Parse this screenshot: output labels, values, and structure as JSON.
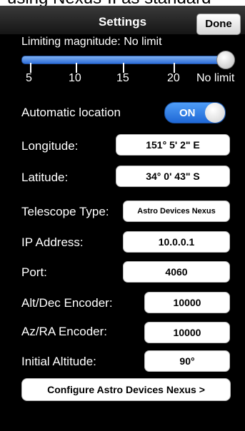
{
  "header_strip": {
    "text": "using Nexus-II as standard"
  },
  "navbar": {
    "title": "Settings",
    "done_label": "Done"
  },
  "limiting_magnitude": {
    "label": "Limiting magnitude: No limit",
    "ticks": [
      "5",
      "10",
      "15",
      "20",
      "No limit"
    ],
    "value": "No limit"
  },
  "automatic_location": {
    "label": "Automatic location",
    "toggle_label": "ON",
    "on": true
  },
  "longitude": {
    "label": "Longitude:",
    "value": "151° 5' 2\" E"
  },
  "latitude": {
    "label": "Latitude:",
    "value": "34° 0' 43\" S"
  },
  "telescope_type": {
    "label": "Telescope Type:",
    "value": "Astro Devices Nexus"
  },
  "ip_address": {
    "label": "IP Address:",
    "value": "10.0.0.1"
  },
  "port": {
    "label": "Port:",
    "value": "4060"
  },
  "alt_dec_encoder": {
    "label": "Alt/Dec Encoder:",
    "value": "10000"
  },
  "az_ra_encoder": {
    "label": "Az/RA Encoder:",
    "value": "10000"
  },
  "initial_altitude": {
    "label": "Initial Altitude:",
    "value": "90°"
  },
  "configure_button": {
    "label": "Configure Astro Devices Nexus >"
  },
  "colors": {
    "toggle_on": "#2f7fe8",
    "slider_fill": "#3a7de0",
    "background": "#000000"
  }
}
